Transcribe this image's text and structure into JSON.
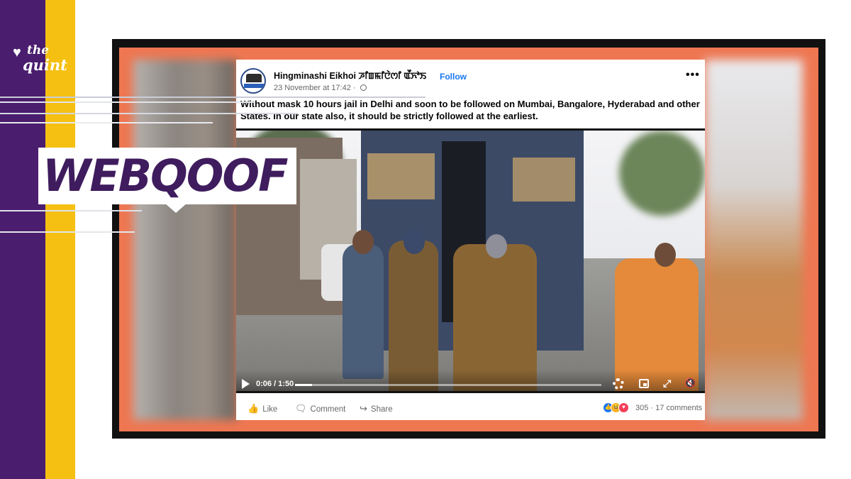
{
  "brand": {
    "logo_the": "the",
    "logo_quint": "quint",
    "colors": {
      "purple": "#4a1d6e",
      "yellow": "#f5c012",
      "frame_orange": "#ee7752"
    }
  },
  "badge": {
    "label": "WEBQOOF"
  },
  "post": {
    "page_name": "Hingminashi Eikhoi ꯍꯤꯡꯃꯤꯅꯥꯁꯤ ꯑꯩꯈꯣꯏ",
    "follow_label": "Follow",
    "timestamp": "23 November at 17:42 · ",
    "more_label": "•••",
    "text": "Without mask 10 hours jail in Delhi and soon to be followed on Mumbai, Bangalore, Hyderabad and other States. In our state also, it should be strictly followed at the earliest."
  },
  "video": {
    "time": "0:06 / 1:50",
    "progress_fraction": 0.055,
    "icons": [
      "play-icon",
      "gear-icon",
      "pip-icon",
      "expand-icon",
      "mute-icon"
    ],
    "expand_glyph": "⤢",
    "mute_glyph": "🔇"
  },
  "actions": {
    "like": "Like",
    "comment": "Comment",
    "share": "Share",
    "reaction_count": "305",
    "comments_count": "17 comments",
    "separator": "·",
    "like_glyph": "👍",
    "comment_glyph": "🗨",
    "share_glyph": "↪",
    "rx_like": "👍",
    "rx_haha": "😆",
    "rx_love": "♥"
  }
}
